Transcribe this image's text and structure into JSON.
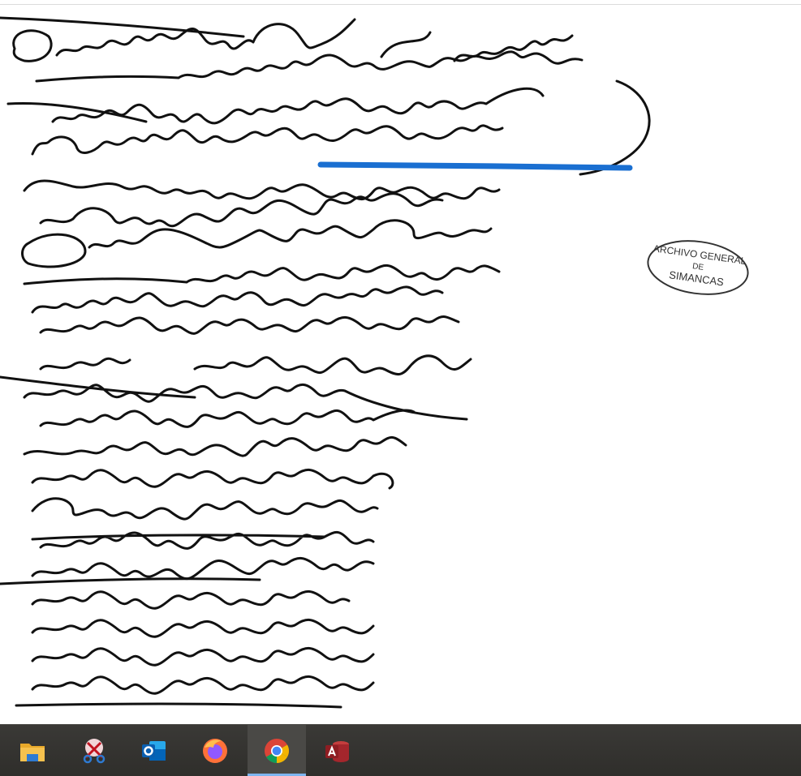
{
  "viewer": {
    "content": "scanned handwritten manuscript page",
    "stamp": {
      "line1": "ARCHIVO GENERAL",
      "line2": "DE",
      "line3": "SIMANCAS"
    },
    "underline_color": "#1a6fd1"
  },
  "taskbar": {
    "background": "#33322f",
    "items": [
      {
        "name": "file-explorer",
        "icon": "folder-icon",
        "active": false
      },
      {
        "name": "snipping-tool",
        "icon": "scissors-icon",
        "active": false
      },
      {
        "name": "outlook",
        "icon": "outlook-icon",
        "active": false
      },
      {
        "name": "firefox",
        "icon": "firefox-icon",
        "active": false
      },
      {
        "name": "chrome",
        "icon": "chrome-icon",
        "active": true
      },
      {
        "name": "access",
        "icon": "access-icon",
        "active": false
      }
    ]
  }
}
